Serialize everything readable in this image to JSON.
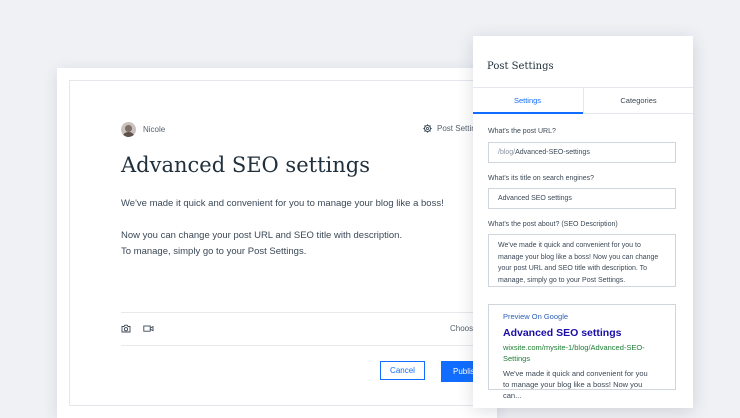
{
  "editor": {
    "author_name": "Nicole",
    "post_settings_link": "Post Settings",
    "title": "Advanced SEO settings",
    "paragraph1": "We've made it quick and convenient for you to manage your blog like a boss!",
    "paragraph2_line1": "Now you can change your post URL and SEO title with description.",
    "paragraph2_line2": "To manage, simply go to your Post Settings.",
    "choose_label": "Choose",
    "cancel_label": "Cancel",
    "publish_label": "Publish"
  },
  "panel": {
    "title": "Post Settings",
    "tabs": [
      {
        "label": "Settings",
        "active": true
      },
      {
        "label": "Categories",
        "active": false
      }
    ],
    "url_label": "What's the post URL?",
    "url_prefix": "/blog/",
    "url_value": "Advanced-SEO-settings",
    "seo_title_label": "What's its title on search engines?",
    "seo_title_value": "Advanced SEO settings",
    "description_label": "What's the post about? (SEO Description)",
    "description_value": "We've made it quick and convenient for you to manage your blog like a boss! Now you can change your post URL and SEO title with description. To manage, simply go to your Post Settings.",
    "preview": {
      "label": "Preview On Google",
      "title": "Advanced SEO settings",
      "url": "wixsite.com/mysite-1/blog/Advanced-SEO-Settings",
      "description": "We've made it quick and convenient for you\nto manage your blog like a boss! Now you can..."
    }
  },
  "colors": {
    "accent": "#116dff",
    "background": "#eff1f5",
    "google_title": "#1a0dab",
    "google_url": "#1e7e34"
  },
  "icons": {
    "settings": "gear-icon",
    "photo": "camera-icon",
    "video": "video-icon"
  }
}
